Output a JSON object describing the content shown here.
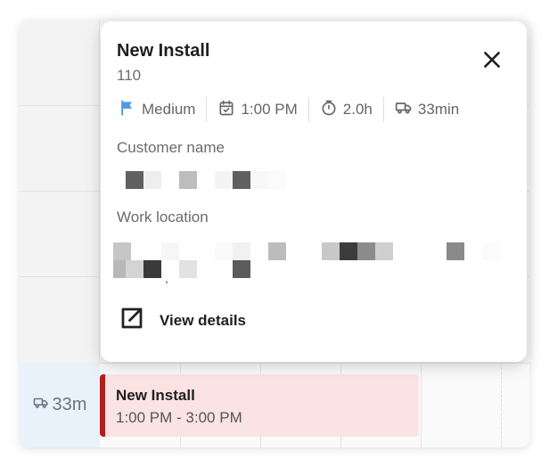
{
  "calendar": {
    "travel_label": "33m",
    "event": {
      "title": "New Install",
      "time": "1:00 PM - 3:00 PM"
    }
  },
  "popover": {
    "title": "New Install",
    "subtitle": "110",
    "meta": {
      "priority": "Medium",
      "start_time": "1:00 PM",
      "duration": "2.0h",
      "travel": "33min"
    },
    "customer_label": "Customer name",
    "location_label": "Work location",
    "location_punct": ",",
    "view_details_label": "View details"
  },
  "colors": {
    "priority_flag": "#4a9be0",
    "event_bg": "#fbe3e3",
    "event_border": "#b21f1f",
    "travel_cell_bg": "#e8f2fa"
  },
  "icons": {
    "priority": "flag-icon",
    "start_time": "calendar-check-icon",
    "duration": "stopwatch-icon",
    "travel": "truck-icon",
    "close": "close-icon",
    "view_details": "external-link-icon"
  }
}
